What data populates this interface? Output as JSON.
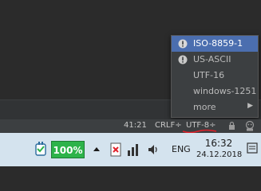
{
  "popup": {
    "items": [
      {
        "label": "ISO-8859-1",
        "icon": "warning-icon",
        "selected": true
      },
      {
        "label": "US-ASCII",
        "icon": "warning-icon",
        "selected": false
      },
      {
        "label": "UTF-16",
        "icon": "",
        "selected": false
      },
      {
        "label": "windows-1251",
        "icon": "",
        "selected": false
      },
      {
        "label": "more",
        "icon": "",
        "selected": false,
        "submenu": true
      }
    ]
  },
  "status_bar": {
    "position": "41:21",
    "line_separator": "CRLF÷",
    "encoding": "UTF-8÷"
  },
  "taskbar": {
    "battery_percent": "100%",
    "language": "ENG",
    "time": "16:32",
    "date": "24.12.2018"
  },
  "colors": {
    "menu_selected": "#4b6eaf",
    "battery_green": "#2db34a",
    "annotation_red": "#e0202a",
    "taskbar_bg": "#d4e3ee"
  }
}
